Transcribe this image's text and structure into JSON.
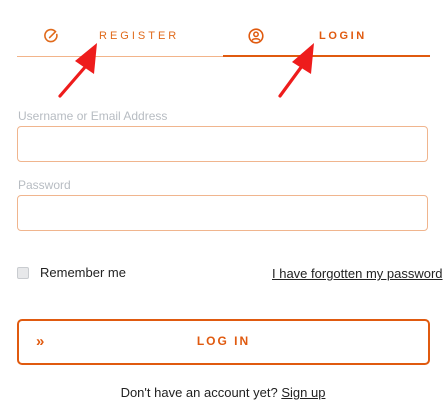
{
  "tabs": {
    "register": {
      "label": "REGISTER",
      "icon": "edit-icon"
    },
    "login": {
      "label": "LOGIN",
      "icon": "user-circle-icon",
      "active": true
    }
  },
  "form": {
    "username_label": "Username or Email Address",
    "username_value": "",
    "password_label": "Password",
    "password_value": "",
    "remember_label": "Remember me",
    "remember_checked": false,
    "forgot_link": "I have forgotten my password",
    "login_button": "LOG IN",
    "login_button_icon": "double-chevron-right-icon"
  },
  "signup": {
    "prompt": "Don't have an account yet?",
    "link": "Sign up"
  },
  "colors": {
    "accent": "#e05a0f",
    "accent_light": "#f0b58e",
    "annotation_arrow": "#ee1c1c"
  }
}
